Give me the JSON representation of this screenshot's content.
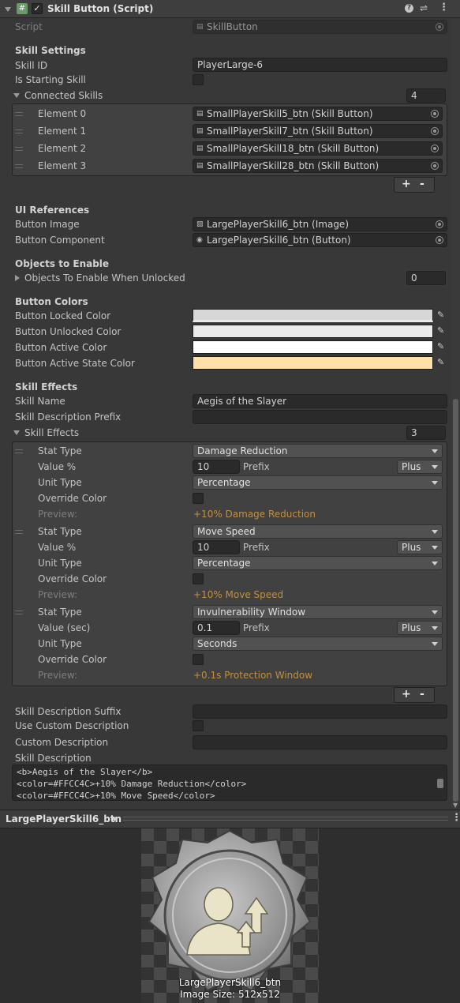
{
  "header": {
    "title": "Skill Button (Script)"
  },
  "script": {
    "label": "Script",
    "value": "SkillButton"
  },
  "skill_settings": {
    "heading": "Skill Settings",
    "skill_id_label": "Skill ID",
    "skill_id_value": "PlayerLarge-6",
    "is_starting_label": "Is Starting Skill",
    "connected_label": "Connected Skills",
    "connected_count": "4",
    "elements": [
      {
        "label": "Element 0",
        "value": "SmallPlayerSkill5_btn (Skill Button)"
      },
      {
        "label": "Element 1",
        "value": "SmallPlayerSkill7_btn (Skill Button)"
      },
      {
        "label": "Element 2",
        "value": "SmallPlayerSkill18_btn (Skill Button)"
      },
      {
        "label": "Element 3",
        "value": "SmallPlayerSkill28_btn (Skill Button)"
      }
    ]
  },
  "list_buttons": {
    "plus": "+",
    "minus": "-"
  },
  "ui_refs": {
    "heading": "UI References",
    "image_label": "Button Image",
    "image_value": "LargePlayerSkill6_btn (Image)",
    "component_label": "Button Component",
    "component_value": "LargePlayerSkill6_btn (Button)"
  },
  "objects": {
    "heading": "Objects to Enable",
    "when_unlocked_label": "Objects To Enable When Unlocked",
    "count": "0"
  },
  "colors": {
    "heading": "Button Colors",
    "locked_label": "Button Locked Color",
    "unlocked_label": "Button Unlocked Color",
    "active_label": "Button Active Color",
    "active_state_label": "Button Active State Color",
    "locked": "#d7d7d7",
    "unlocked": "#ececec",
    "active": "#ffffff",
    "active_state": "#ffe0a8"
  },
  "effects": {
    "heading": "Skill Effects",
    "name_label": "Skill Name",
    "name_value": "Aegis of the Slayer",
    "desc_prefix_label": "Skill Description Prefix",
    "list_label": "Skill Effects",
    "count": "3",
    "items": [
      {
        "stat_label": "Stat Type",
        "stat": "Damage Reduction",
        "value_label": "Value %",
        "value": "10",
        "prefix_label": "Prefix",
        "prefix": "Plus",
        "unit_label": "Unit Type",
        "unit": "Percentage",
        "override_label": "Override Color",
        "preview_label": "Preview:",
        "preview": "+10% Damage Reduction"
      },
      {
        "stat_label": "Stat Type",
        "stat": "Move Speed",
        "value_label": "Value %",
        "value": "10",
        "prefix_label": "Prefix",
        "prefix": "Plus",
        "unit_label": "Unit Type",
        "unit": "Percentage",
        "override_label": "Override Color",
        "preview_label": "Preview:",
        "preview": "+10% Move Speed"
      },
      {
        "stat_label": "Stat Type",
        "stat": "Invulnerability Window",
        "value_label": "Value (sec)",
        "value": "0.1",
        "prefix_label": "Prefix",
        "prefix": "Plus",
        "unit_label": "Unit Type",
        "unit": "Seconds",
        "override_label": "Override Color",
        "preview_label": "Preview:",
        "preview": "+0.1s Protection Window"
      }
    ],
    "preview_color": "#c09040"
  },
  "description": {
    "suffix_label": "Skill Description Suffix",
    "use_custom_label": "Use Custom Description",
    "custom_label": "Custom Description",
    "desc_label": "Skill Description",
    "lines": [
      "<b>Aegis of the Slayer</b>",
      "<color=#FFCC4C>+10% Damage Reduction</color>",
      "<color=#FFCC4C>+10% Move Speed</color>"
    ]
  },
  "preview_panel": {
    "object_name": "LargePlayerSkill6_btn",
    "image_name": "LargePlayerSkill6_btn",
    "image_size": "Image Size: 512x512"
  }
}
